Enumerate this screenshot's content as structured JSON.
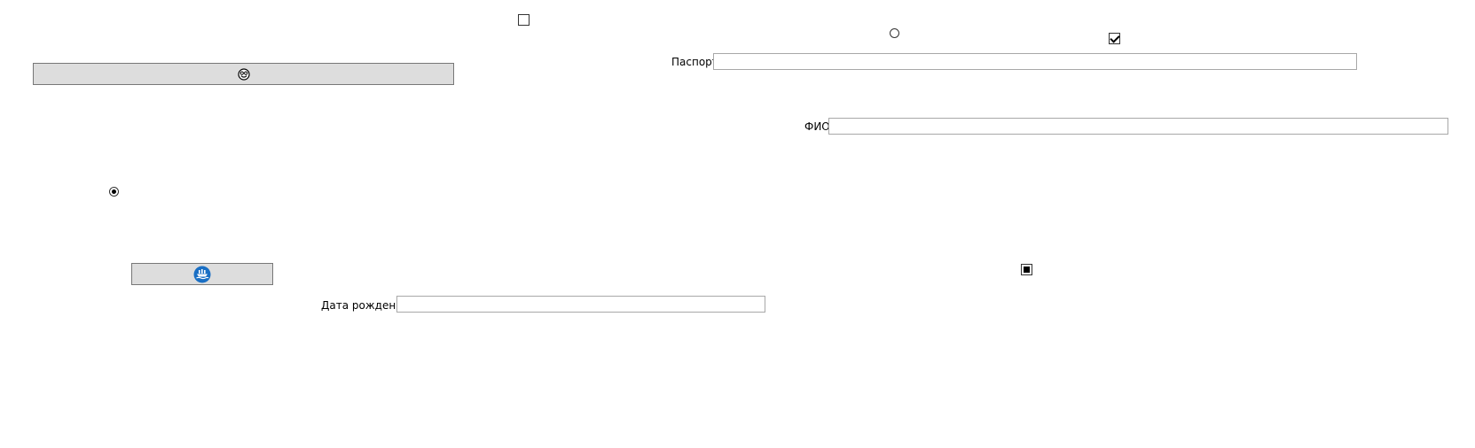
{
  "controls": {
    "checkbox_top": {
      "checked": false
    },
    "radio_top": {
      "checked": false
    },
    "checkbox_right": {
      "checked": true
    },
    "radio_left": {
      "checked": true
    },
    "checkbox_bottom_right": {
      "state": "indeterminate"
    }
  },
  "buttons": {
    "top": {
      "icon": "smiley-icon"
    },
    "bottom": {
      "icon": "ship-icon",
      "icon_color": "#1a6fc4"
    }
  },
  "fields": {
    "passport": {
      "label": "Паспорт",
      "value": ""
    },
    "fio": {
      "label": "ФИО",
      "value": ""
    },
    "birthdate": {
      "label": "Дата рождения",
      "value": ""
    }
  }
}
